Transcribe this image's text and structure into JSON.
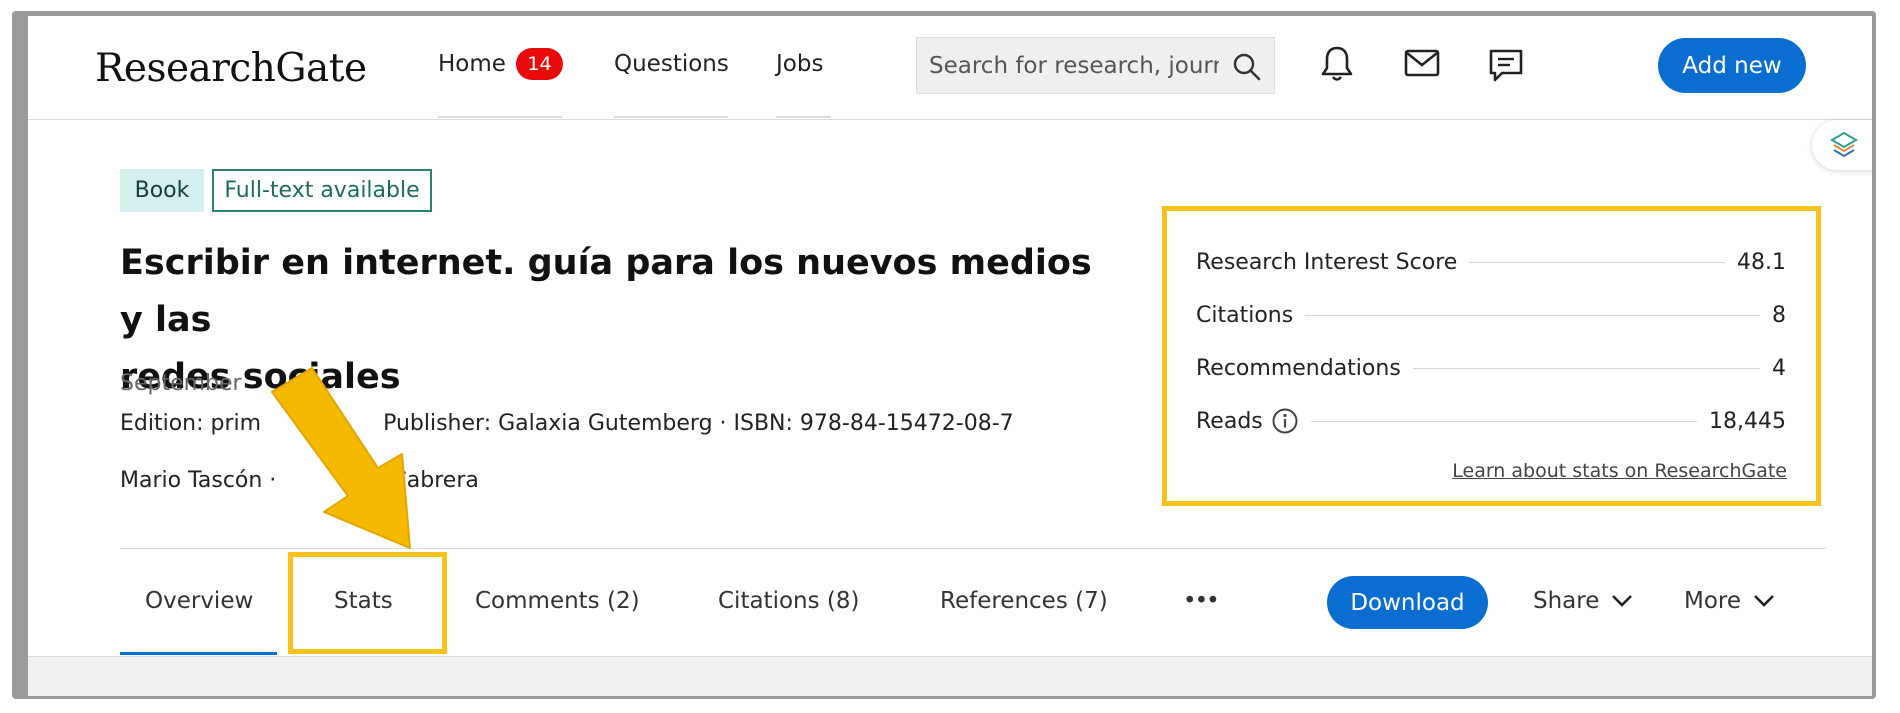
{
  "header": {
    "logo": "ResearchGate",
    "nav": [
      {
        "label": "Home"
      },
      {
        "label": "Questions"
      },
      {
        "label": "Jobs"
      }
    ],
    "home_badge": "14",
    "search_placeholder": "Search for research, journ",
    "add_new_label": "Add new"
  },
  "publication": {
    "tag_type": "Book",
    "tag_fulltext": "Full-text available",
    "title_line1": "Escribir en internet. guía para los nuevos medios y las",
    "title_line2": "redes sociales",
    "date_partial": "September",
    "edition_line_start": "Edition: prim",
    "edition_line_end": "Publisher: Galaxia Gutemberg · ISBN: 978-84-15472-08-7",
    "authors_start": "Mario Tascón ·",
    "authors_end": "rga Cabrera"
  },
  "stats": {
    "rows": [
      {
        "label": "Research Interest Score",
        "value": "48.1"
      },
      {
        "label": "Citations",
        "value": "8"
      },
      {
        "label": "Recommendations",
        "value": "4"
      },
      {
        "label": "Reads",
        "value": "18,445"
      }
    ],
    "learn_link": "Learn about stats on ResearchGate"
  },
  "tabs": [
    {
      "label": "Overview"
    },
    {
      "label": "Stats"
    },
    {
      "label": "Comments (2)"
    },
    {
      "label": "Citations (8)"
    },
    {
      "label": "References (7)"
    },
    {
      "label": "•••"
    }
  ],
  "actions": {
    "download": "Download",
    "share": "Share",
    "more": "More"
  },
  "colors": {
    "brand_blue": "#0a6ed1",
    "highlight_yellow": "#f7c21b",
    "badge_red": "#e80a0a",
    "book_tag_bg": "#d4f0ee",
    "fulltext_border": "#2f7e73"
  },
  "icons": [
    "search-icon",
    "bell-icon",
    "mail-icon",
    "chat-icon",
    "info-icon",
    "chevron-down-icon",
    "pointer-arrow-icon",
    "layers-icon"
  ]
}
